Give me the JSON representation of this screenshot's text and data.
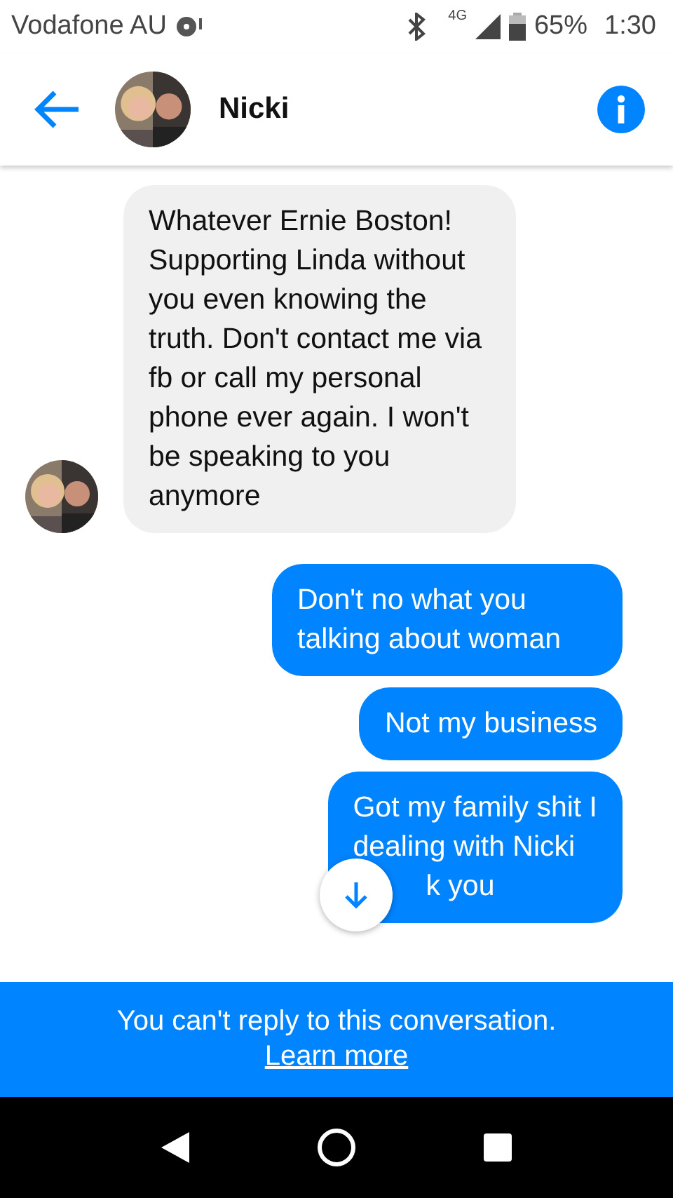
{
  "status_bar": {
    "carrier": "Vodafone AU",
    "network": "4G",
    "battery": "65%",
    "time": "1:30"
  },
  "header": {
    "title": "Nicki"
  },
  "messages": [
    {
      "kind": "received",
      "lines": [
        "Whatever Ernie Boston! Supporting Linda without you even knowing the truth. Don't contact me via fb or call my personal phone ever again. I won't be speaking to you anymore"
      ]
    },
    {
      "kind": "sent",
      "lines": [
        "Don't no what you talking about woman"
      ]
    },
    {
      "kind": "sent",
      "lines": [
        "Not my business"
      ]
    },
    {
      "kind": "sent",
      "lines": [
        "Got my family shit I",
        "dealing with Nicki",
        "k you"
      ]
    }
  ],
  "banner": {
    "text": "You can't reply to this conversation.",
    "link": "Learn more"
  }
}
